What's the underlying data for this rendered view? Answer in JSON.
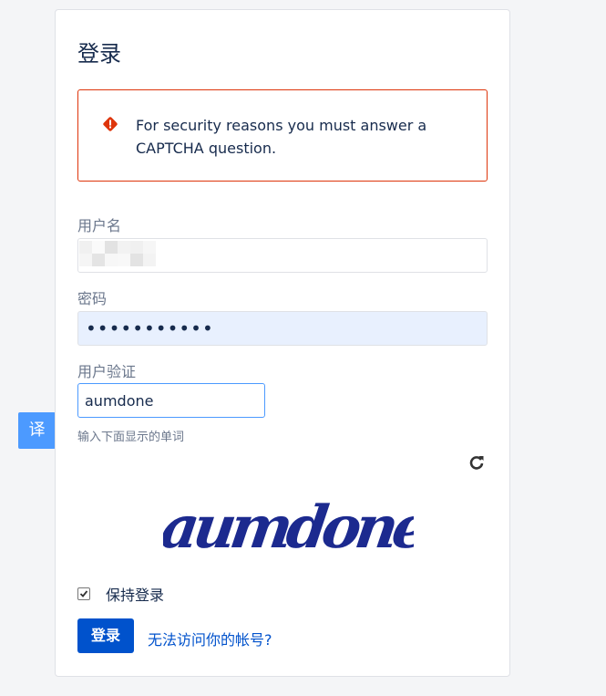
{
  "login": {
    "title": "登录",
    "alert": {
      "message": "For security reasons you must answer a CAPTCHA question.",
      "icon": "error-icon",
      "color": "#de350b"
    },
    "username": {
      "label": "用户名",
      "value": ""
    },
    "password": {
      "label": "密码",
      "value": "•••••••••••"
    },
    "captcha": {
      "label": "用户验证",
      "value": "aumdone",
      "hint": "输入下面显示的单词",
      "image_text": "aumdone"
    },
    "remember": {
      "label": "保持登录",
      "checked": true
    },
    "submit_label": "登录",
    "help_link": "无法访问你的帐号?"
  },
  "translate_button": "译",
  "colors": {
    "primary": "#0052cc",
    "input_focus": "#4c9aff",
    "autofill": "#e8f0fe"
  }
}
